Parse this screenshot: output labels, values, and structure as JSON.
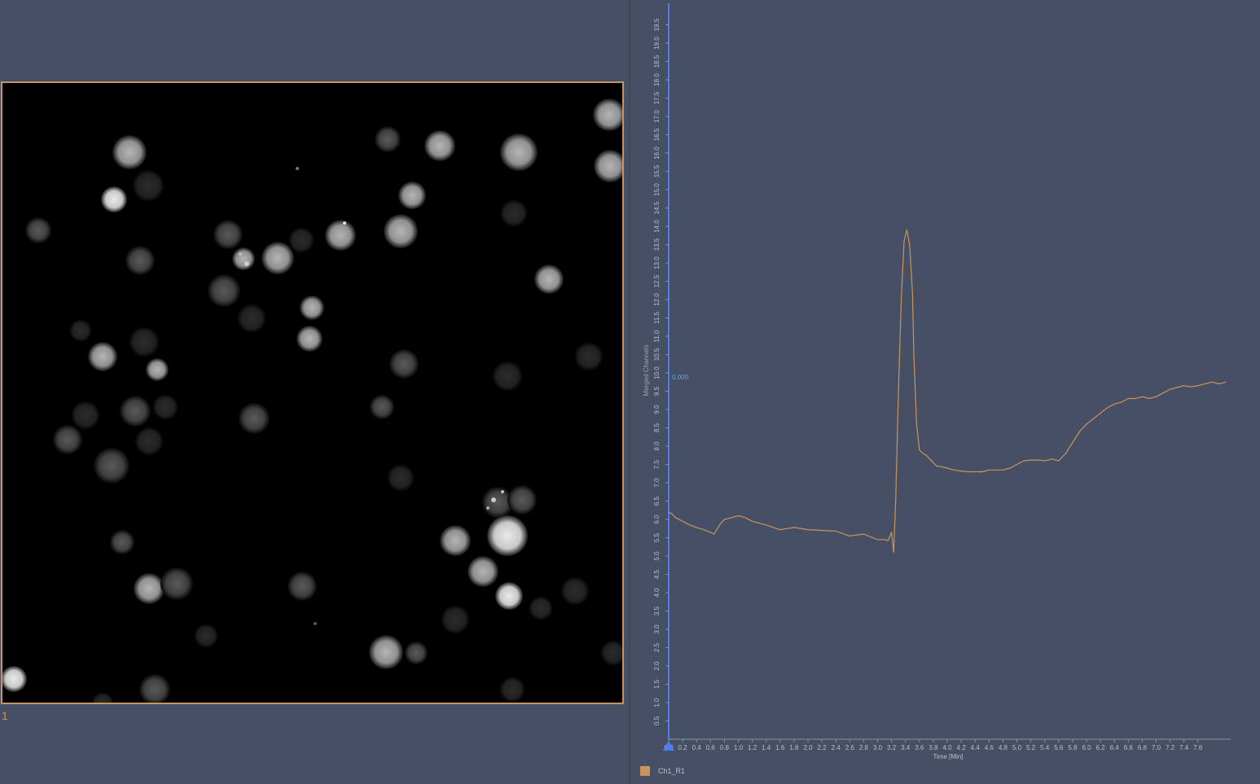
{
  "roi": {
    "label": "1"
  },
  "colors": {
    "background": "#464f63",
    "series": "#c8955e",
    "axis": "#4a7df0",
    "frame": "#c8955e"
  },
  "chart_data": {
    "type": "line",
    "title": "",
    "xlabel": "Time [Min]",
    "ylabel": "Merged Channels",
    "xlim": [
      0,
      8.0
    ],
    "ylim": [
      0,
      20
    ],
    "x_ticks": [
      "0.0",
      "0.2",
      "0.4",
      "0.6",
      "0.8",
      "1.0",
      "1.2",
      "1.4",
      "1.6",
      "1.8",
      "2.0",
      "2.2",
      "2.4",
      "2.6",
      "2.8",
      "3.0",
      "3.2",
      "3.4",
      "3.6",
      "3.8",
      "4.0",
      "4.2",
      "4.4",
      "4.6",
      "4.8",
      "5.0",
      "5.2",
      "5.4",
      "5.6",
      "5.8",
      "6.0",
      "6.2",
      "6.4",
      "6.6",
      "6.8",
      "7.0",
      "7.2",
      "7.4",
      "7.6"
    ],
    "y_ticks": [
      "0.5",
      "1.0",
      "1.5",
      "2.0",
      "2.5",
      "3.0",
      "3.5",
      "4.0",
      "4.5",
      "5.0",
      "5.5",
      "6.0",
      "6.5",
      "7.0",
      "7.5",
      "8.0",
      "8.5",
      "9.0",
      "9.5",
      "10.0",
      "10.5",
      "11.0",
      "11.5",
      "12.0",
      "12.5",
      "13.0",
      "13.5",
      "14.0",
      "14.5",
      "15.0",
      "15.5",
      "16.0",
      "16.5",
      "17.0",
      "17.5",
      "18.0",
      "18.5",
      "19.0",
      "19.5"
    ],
    "marker_value": "0.000",
    "grid": false,
    "legend_position": "bottom-left",
    "series": [
      {
        "name": "Ch1_R1",
        "color": "#c8955e",
        "x": [
          0,
          0.05,
          0.1,
          0.2,
          0.3,
          0.4,
          0.5,
          0.6,
          0.65,
          0.7,
          0.75,
          0.8,
          0.9,
          1.0,
          1.1,
          1.2,
          1.4,
          1.5,
          1.6,
          1.7,
          1.8,
          2.0,
          2.2,
          2.4,
          2.6,
          2.8,
          3.0,
          3.1,
          3.15,
          3.2,
          3.23,
          3.26,
          3.3,
          3.34,
          3.38,
          3.42,
          3.46,
          3.5,
          3.52,
          3.56,
          3.6,
          3.65,
          3.7,
          3.75,
          3.8,
          3.85,
          3.9,
          4.0,
          4.1,
          4.2,
          4.3,
          4.4,
          4.5,
          4.6,
          4.7,
          4.8,
          4.9,
          5.0,
          5.1,
          5.2,
          5.3,
          5.4,
          5.5,
          5.6,
          5.7,
          5.8,
          5.9,
          6.0,
          6.1,
          6.2,
          6.3,
          6.4,
          6.5,
          6.6,
          6.7,
          6.8,
          6.9,
          7.0,
          7.1,
          7.2,
          7.3,
          7.4,
          7.5,
          7.6,
          7.7,
          7.8,
          7.9,
          8.0
        ],
        "values": [
          6.2,
          6.15,
          6.05,
          5.95,
          5.85,
          5.78,
          5.72,
          5.65,
          5.6,
          5.75,
          5.9,
          6.0,
          6.05,
          6.1,
          6.05,
          5.95,
          5.85,
          5.78,
          5.72,
          5.75,
          5.78,
          5.72,
          5.7,
          5.68,
          5.55,
          5.6,
          5.45,
          5.45,
          5.42,
          5.65,
          5.1,
          6.5,
          9.5,
          12.0,
          13.6,
          13.9,
          13.5,
          12.2,
          10.5,
          8.6,
          7.9,
          7.8,
          7.75,
          7.65,
          7.55,
          7.45,
          7.45,
          7.4,
          7.35,
          7.32,
          7.3,
          7.3,
          7.3,
          7.35,
          7.35,
          7.35,
          7.4,
          7.5,
          7.6,
          7.62,
          7.62,
          7.6,
          7.65,
          7.6,
          7.8,
          8.1,
          8.4,
          8.6,
          8.75,
          8.9,
          9.05,
          9.15,
          9.2,
          9.3,
          9.3,
          9.35,
          9.3,
          9.35,
          9.45,
          9.55,
          9.6,
          9.65,
          9.62,
          9.65,
          9.7,
          9.75,
          9.7,
          9.75
        ]
      }
    ]
  },
  "legend": {
    "label": "Ch1_R1"
  }
}
